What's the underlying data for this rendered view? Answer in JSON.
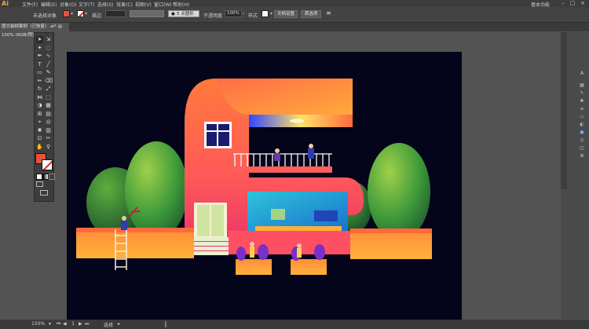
{
  "app": {
    "logo": "Ai"
  },
  "menu": [
    "文件(F)",
    "编辑(E)",
    "对象(O)",
    "文字(T)",
    "选择(S)",
    "效果(C)",
    "视图(V)",
    "窗口(W)",
    "帮助(H)"
  ],
  "workspace": "基本功能",
  "window_controls": [
    "–",
    "□",
    "×"
  ],
  "control_bar": {
    "selection_label": "未选择对象",
    "stroke_label": "描边",
    "brush_label": "5 点圆形",
    "opacity_label": "不透明度",
    "opacity_value": "100%",
    "style_label": "样式",
    "doc_setup_button": "文档设置",
    "prefs_button": "首选项"
  },
  "document_tab": "图文装帧案例（已恢复）.ai* @ 150% (RGB/预览)",
  "right_panel_letter": "A",
  "status": {
    "zoom": "150%",
    "page": "1",
    "mode": "选择"
  },
  "colors": {
    "accent": "#f7a23a",
    "fill": "#e8503a",
    "artboard": "#04041a"
  }
}
